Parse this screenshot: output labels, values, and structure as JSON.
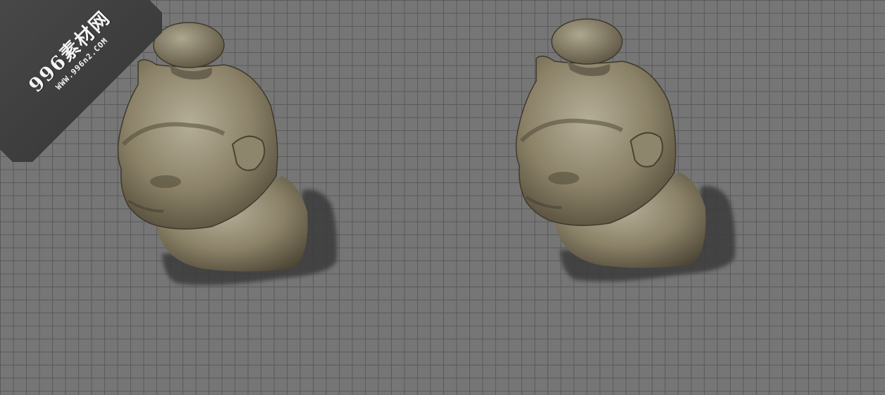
{
  "watermark": {
    "name": "996素材网",
    "url": "WWW.996n2.COM"
  },
  "scene": {
    "background_color": "#767676",
    "grid_line_color": "#5b5b5b",
    "object": "stone-bust-head-with-topknot",
    "object_count": 2,
    "stone_colors": {
      "light": "#b5ae97",
      "mid": "#8a8167",
      "dark": "#4d4635",
      "shadow": "#3a3a3a"
    }
  }
}
